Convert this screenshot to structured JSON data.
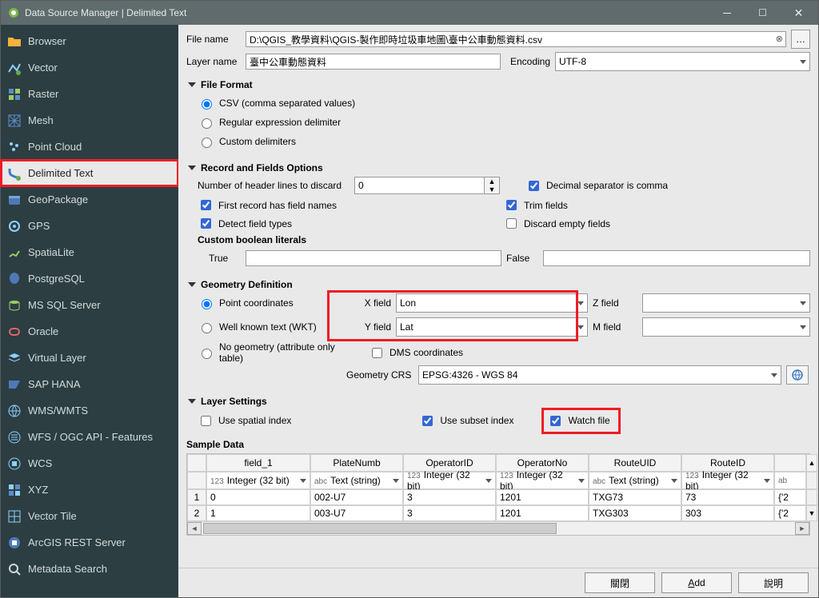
{
  "window": {
    "title": "Data Source Manager | Delimited Text"
  },
  "sidebar": {
    "items": [
      {
        "label": "Browser"
      },
      {
        "label": "Vector"
      },
      {
        "label": "Raster"
      },
      {
        "label": "Mesh"
      },
      {
        "label": "Point Cloud"
      },
      {
        "label": "Delimited Text"
      },
      {
        "label": "GeoPackage"
      },
      {
        "label": "GPS"
      },
      {
        "label": "SpatiaLite"
      },
      {
        "label": "PostgreSQL"
      },
      {
        "label": "MS SQL Server"
      },
      {
        "label": "Oracle"
      },
      {
        "label": "Virtual Layer"
      },
      {
        "label": "SAP HANA"
      },
      {
        "label": "WMS/WMTS"
      },
      {
        "label": "WFS / OGC API - Features"
      },
      {
        "label": "WCS"
      },
      {
        "label": "XYZ"
      },
      {
        "label": "Vector Tile"
      },
      {
        "label": "ArcGIS REST Server"
      },
      {
        "label": "Metadata Search"
      }
    ]
  },
  "file": {
    "name_label": "File name",
    "name_value": "D:\\QGIS_教學資料\\QGIS-製作即時垃圾車地圖\\臺中公車動態資料.csv",
    "layer_label": "Layer name",
    "layer_value": "臺中公車動態資料",
    "encoding_label": "Encoding",
    "encoding_value": "UTF-8"
  },
  "file_format": {
    "title": "File Format",
    "csv": "CSV (comma separated values)",
    "regex": "Regular expression delimiter",
    "custom": "Custom delimiters"
  },
  "records": {
    "title": "Record and Fields Options",
    "header_lines": "Number of header lines to discard",
    "header_value": "0",
    "first_record": "First record has field names",
    "detect": "Detect field types",
    "decimal": "Decimal separator is comma",
    "trim": "Trim fields",
    "discard": "Discard empty fields",
    "custom_bool": "Custom boolean literals",
    "true": "True",
    "false": "False"
  },
  "geom": {
    "title": "Geometry Definition",
    "point": "Point coordinates",
    "wkt": "Well known text (WKT)",
    "none": "No geometry (attribute only table)",
    "xfield": "X field",
    "xval": "Lon",
    "yfield": "Y field",
    "yval": "Lat",
    "zfield": "Z field",
    "mfield": "M field",
    "dms": "DMS coordinates",
    "crs_label": "Geometry CRS",
    "crs_value": "EPSG:4326 - WGS 84"
  },
  "layer_settings": {
    "title": "Layer Settings",
    "spatial": "Use spatial index",
    "subset": "Use subset index",
    "watch": "Watch file"
  },
  "sample": {
    "title": "Sample Data",
    "headers": [
      "field_1",
      "PlateNumb",
      "OperatorID",
      "OperatorNo",
      "RouteUID",
      "RouteID"
    ],
    "types": [
      {
        "prefix": "123",
        "label": "Integer (32 bit)"
      },
      {
        "prefix": "abc",
        "label": "Text (string)"
      },
      {
        "prefix": "123",
        "label": "Integer (32 bit)"
      },
      {
        "prefix": "123",
        "label": "Integer (32 bit)"
      },
      {
        "prefix": "abc",
        "label": "Text (string)"
      },
      {
        "prefix": "123",
        "label": "Integer (32 bit)"
      }
    ],
    "rows": [
      {
        "n": "1",
        "c": [
          "0",
          "002-U7",
          "3",
          "1201",
          "TXG73",
          "73",
          "{'2"
        ]
      },
      {
        "n": "2",
        "c": [
          "1",
          "003-U7",
          "3",
          "1201",
          "TXG303",
          "303",
          "{'2"
        ]
      }
    ]
  },
  "buttons": {
    "close": "關閉",
    "add": "Add",
    "add_u": "A",
    "help": "說明"
  }
}
